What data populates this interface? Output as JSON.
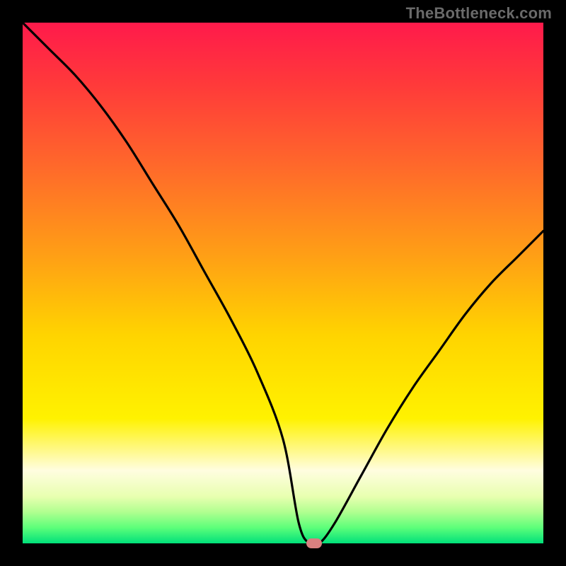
{
  "watermark": "TheBottleneck.com",
  "chart_data": {
    "type": "line",
    "title": "",
    "xlabel": "",
    "ylabel": "",
    "xlim": [
      0,
      100
    ],
    "ylim": [
      0,
      100
    ],
    "series": [
      {
        "name": "bottleneck-curve",
        "x": [
          0,
          5,
          10,
          15,
          20,
          25,
          30,
          35,
          40,
          45,
          50,
          53,
          55,
          57,
          60,
          65,
          70,
          75,
          80,
          85,
          90,
          95,
          100
        ],
        "values": [
          100,
          95,
          90,
          84,
          77,
          69,
          61,
          52,
          43,
          33,
          20,
          4,
          0,
          0,
          4,
          13,
          22,
          30,
          37,
          44,
          50,
          55,
          60
        ]
      }
    ],
    "background_gradient": {
      "top": "#ff1a4b",
      "bottom": "#00e07a"
    },
    "marker": {
      "x": 56,
      "y": 0,
      "color": "#d98080"
    }
  }
}
